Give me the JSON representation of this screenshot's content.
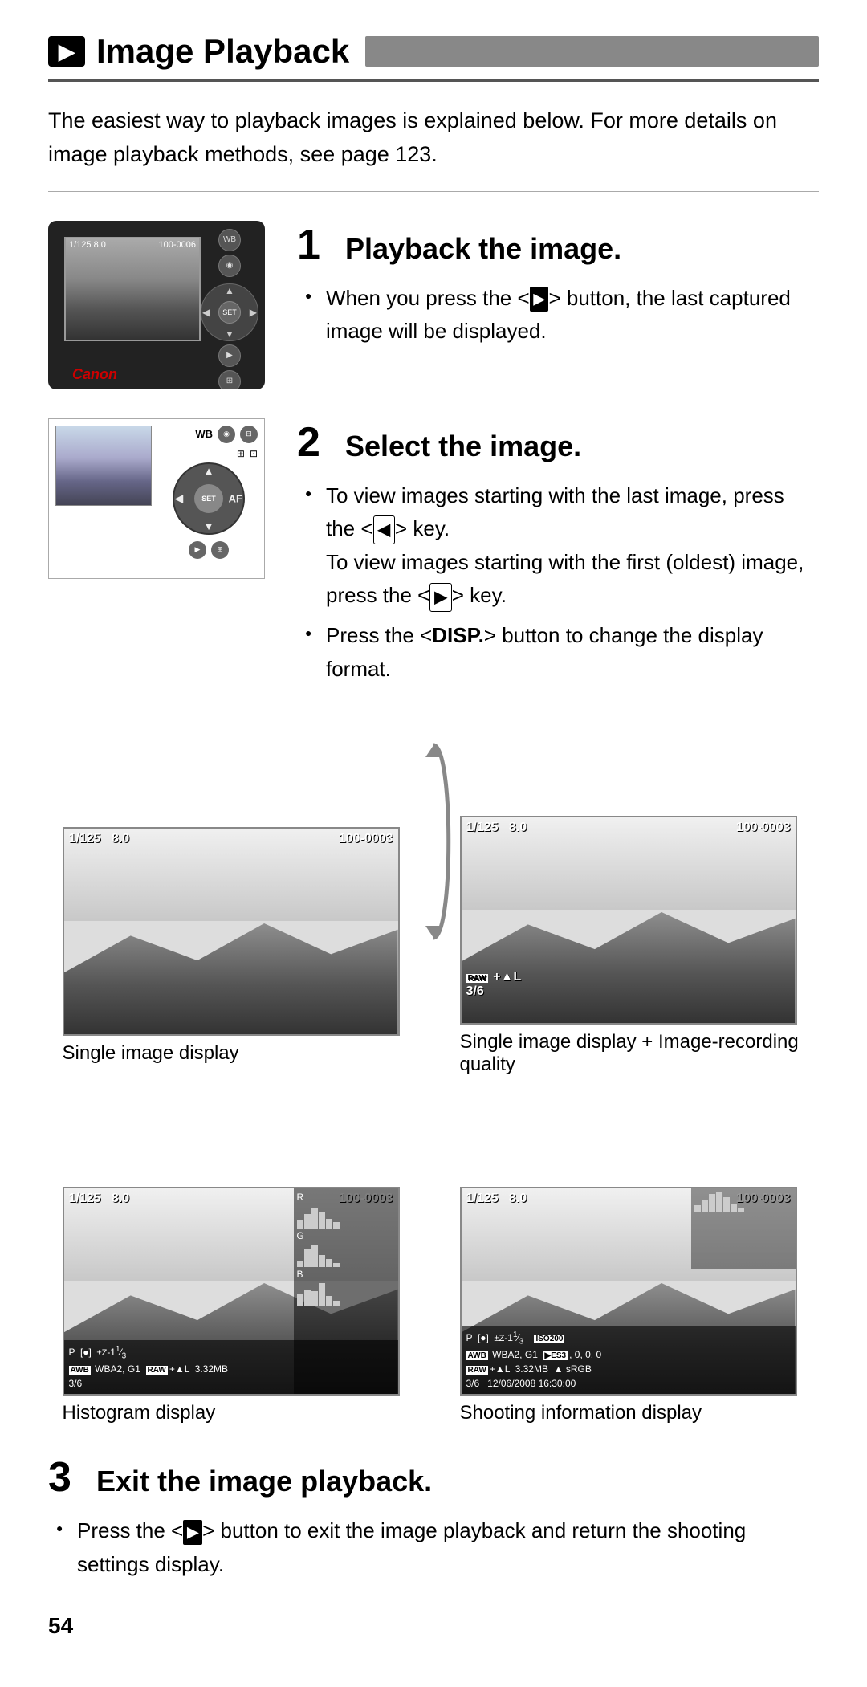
{
  "header": {
    "icon": "▶",
    "title": "Image Playback"
  },
  "intro": {
    "text": "The easiest way to playback images is explained below. For more details on image playback methods, see page 123."
  },
  "steps": [
    {
      "number": "1",
      "heading": "Playback the image.",
      "bullets": [
        "When you press the < ▶ > button, the last captured image will be displayed."
      ]
    },
    {
      "number": "2",
      "heading": "Select the image.",
      "bullets": [
        "To view images starting with the last image, press the < ◀ > key. To view images starting with the first (oldest) image, press the < ▶ > key.",
        "Press the < DISP. > button to change the display format."
      ]
    },
    {
      "number": "3",
      "heading": "Exit the image playback.",
      "bullets": [
        "Press the < ▶ > button to exit the image playback and return the shooting settings display."
      ]
    }
  ],
  "display_formats": [
    {
      "id": "single",
      "label": "Single image display",
      "info_top_left": "1/125   8.0",
      "info_top_right": "100-0003"
    },
    {
      "id": "single_quality",
      "label": "Single image display + Image-recording quality",
      "info_top_left": "1/125   8.0",
      "info_top_right": "100-0003",
      "extra": "RAW +▲L\n3/6"
    },
    {
      "id": "histogram",
      "label": "Histogram display",
      "info_top_left": "1/125   8.0",
      "info_top_right": "100-0003",
      "bottom": "P  [●]  ±Z-11⁄3\nAWB  WBA2, G1   RAW+▲L  3.32MB\n3/6"
    },
    {
      "id": "shooting_info",
      "label": "Shooting information display",
      "info_top_left": "1/125   8.0",
      "info_top_right": "100-0003",
      "bottom": "P  [●]  ±Z-11⁄3   ISO200\nAWB  WBA2, G1  ▶ES3, 0, 0, 0\nRAW+▲L  3.32MB  ▲ sRGB\n3/6  12/06/2008 16:30:00"
    }
  ],
  "page_number": "54",
  "camera1": {
    "screen_info": "1/125  8.0    100-0006",
    "brand": "Canon"
  },
  "camera2": {
    "labels": {
      "wb": "WB",
      "af": "AF",
      "set": "SET"
    }
  }
}
